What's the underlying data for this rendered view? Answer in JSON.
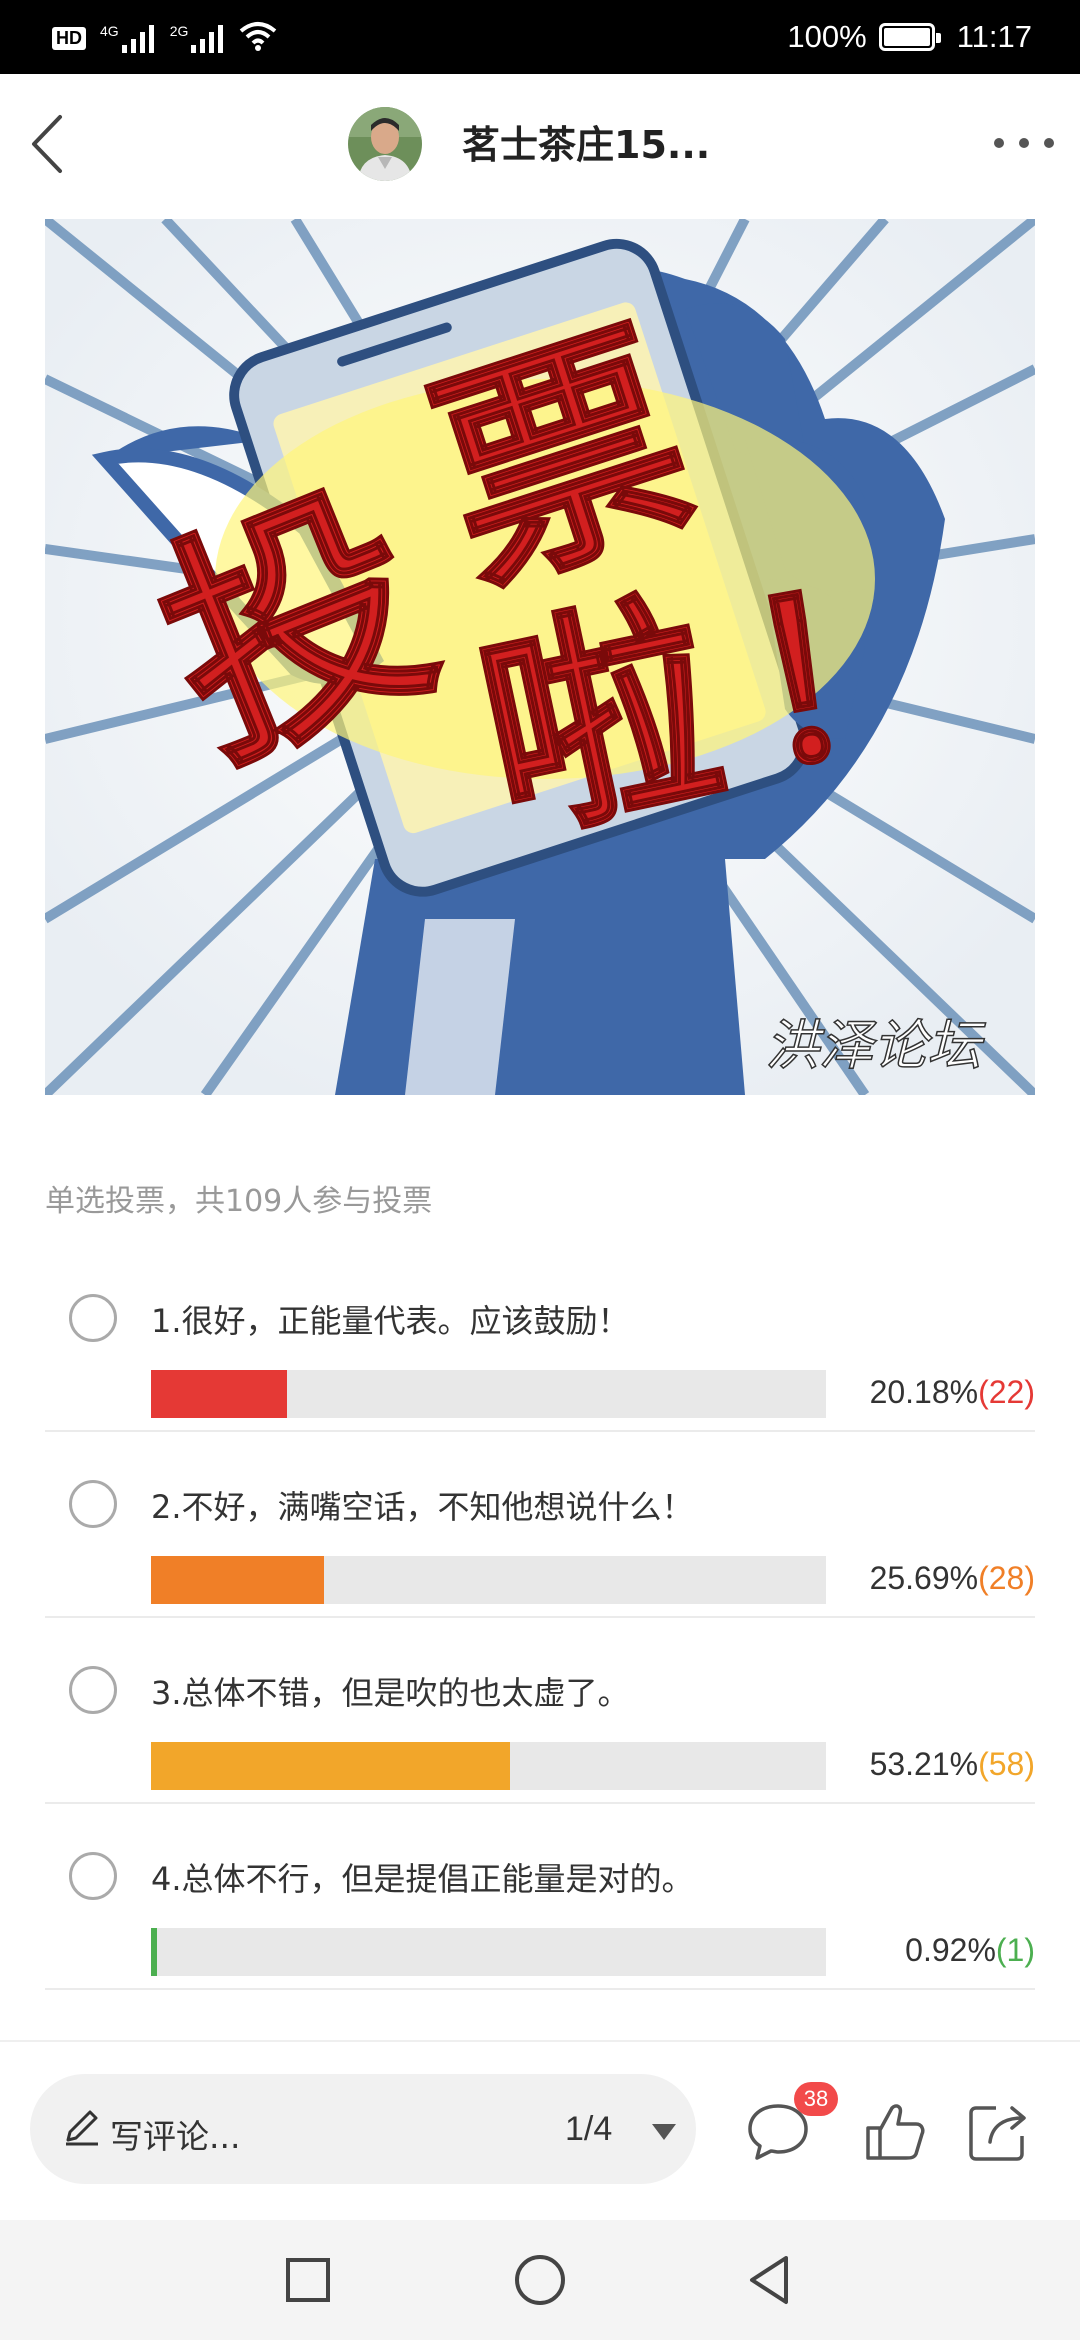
{
  "status_bar": {
    "network": "HD",
    "signal1": "4G",
    "signal2": "2G",
    "battery": "100%",
    "time": "11:17"
  },
  "header": {
    "title": "茗士茶庄15..."
  },
  "banner": {
    "headline_chars": [
      "投",
      "票",
      "啦",
      "！"
    ],
    "watermark": "洪泽论坛"
  },
  "poll": {
    "summary": "单选投票，共109人参与投票",
    "options": [
      {
        "label": "1.很好，正能量代表。应该鼓励！",
        "percent": "20.18%",
        "count": "(22)",
        "fraction": 0.2018,
        "color": "#e53935"
      },
      {
        "label": "2.不好，满嘴空话，不知他想说什么！",
        "percent": "25.69%",
        "count": "(28)",
        "fraction": 0.2569,
        "color": "#f07f27"
      },
      {
        "label": "3.总体不错，但是吹的也太虚了。",
        "percent": "53.21%",
        "count": "(58)",
        "fraction": 0.5321,
        "color": "#f2a62a"
      },
      {
        "label": "4.总体不行，但是提倡正能量是对的。",
        "percent": "0.92%",
        "count": "(1)",
        "fraction": 0.0092,
        "color": "#4caf50"
      }
    ]
  },
  "bottom_bar": {
    "comment_placeholder": "写评论...",
    "page_indicator": "1/4",
    "comment_badge": "38"
  },
  "icons": {
    "back": "chevron-left-icon",
    "more": "more-dots-icon",
    "pen": "pen-icon",
    "caret": "caret-down-icon",
    "comment": "comment-bubble-icon",
    "like": "thumbs-up-icon",
    "share": "share-icon",
    "nav_recent": "square-icon",
    "nav_home": "circle-icon",
    "nav_back": "triangle-back-icon"
  }
}
